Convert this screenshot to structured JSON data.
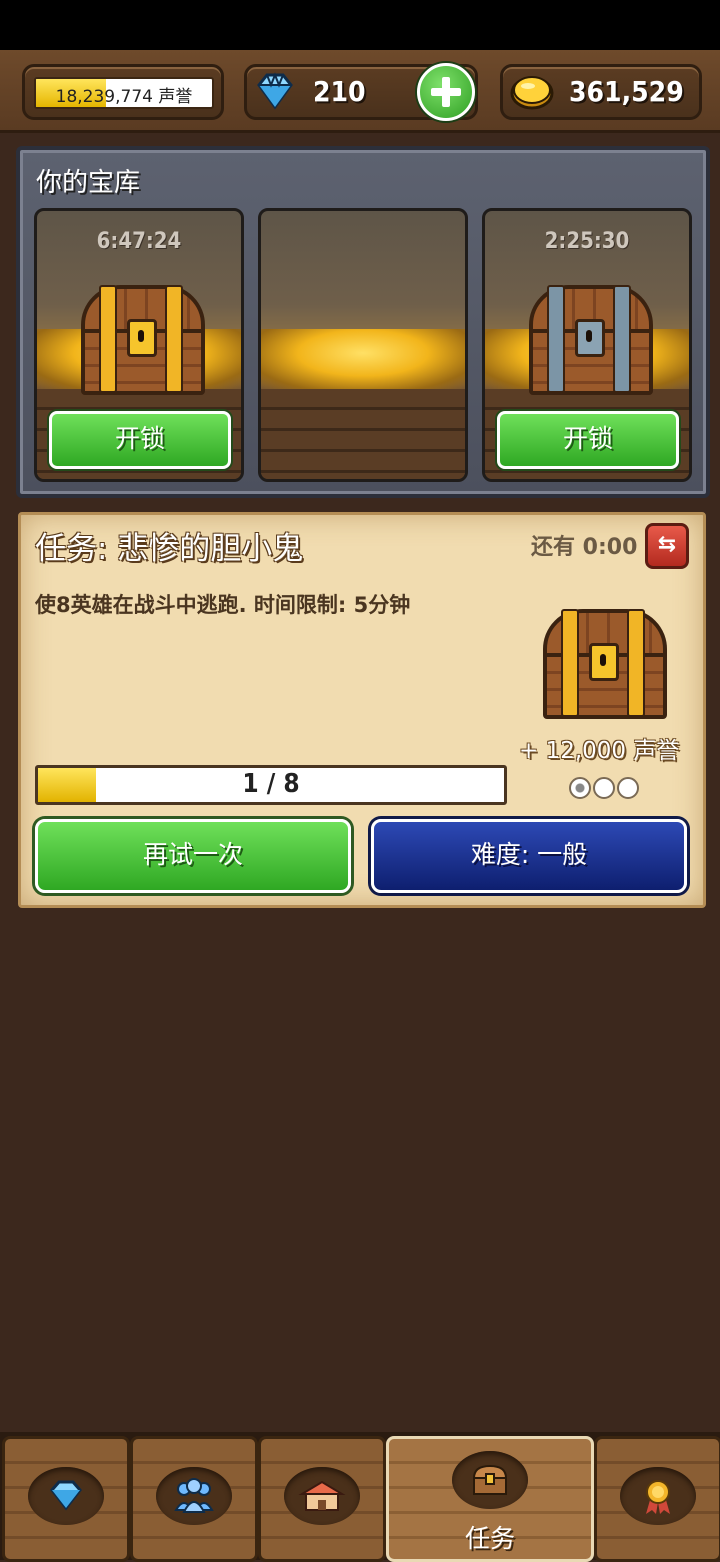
{
  "header": {
    "fame_text": "18,239,774 声誉",
    "fame_fill_percent": 40,
    "gems": "210",
    "gold": "361,529"
  },
  "vault": {
    "title": "你的宝库",
    "slots": [
      {
        "timer": "6:47:24",
        "chest": "gold",
        "button": "开锁"
      },
      {
        "timer": "",
        "chest": "none",
        "button": ""
      },
      {
        "timer": "2:25:30",
        "chest": "silver",
        "button": "开锁"
      }
    ]
  },
  "quest": {
    "title": "任务: 悲惨的胆小鬼",
    "time_left": "还有 0:00",
    "description": "使8英雄在战斗中逃跑. 时间限制: 5分钟",
    "reward": "+ 12,000 声誉",
    "difficulty_stars_filled": 1,
    "difficulty_stars_total": 3,
    "progress_text": "1 / 8",
    "progress_current": 1,
    "progress_total": 8,
    "retry_button": "再试一次",
    "difficulty_button": "难度: 一般"
  },
  "nav": {
    "tabs": [
      {
        "icon": "gem-icon",
        "label": ""
      },
      {
        "icon": "heroes-icon",
        "label": ""
      },
      {
        "icon": "town-icon",
        "label": ""
      },
      {
        "icon": "chest-icon",
        "label": "任务",
        "active": true
      },
      {
        "icon": "medal-icon",
        "label": ""
      }
    ]
  },
  "colors": {
    "green": "#2fa823",
    "blue": "#0e1f6f",
    "gold": "#f2b51b",
    "wood": "#5a3b22"
  }
}
